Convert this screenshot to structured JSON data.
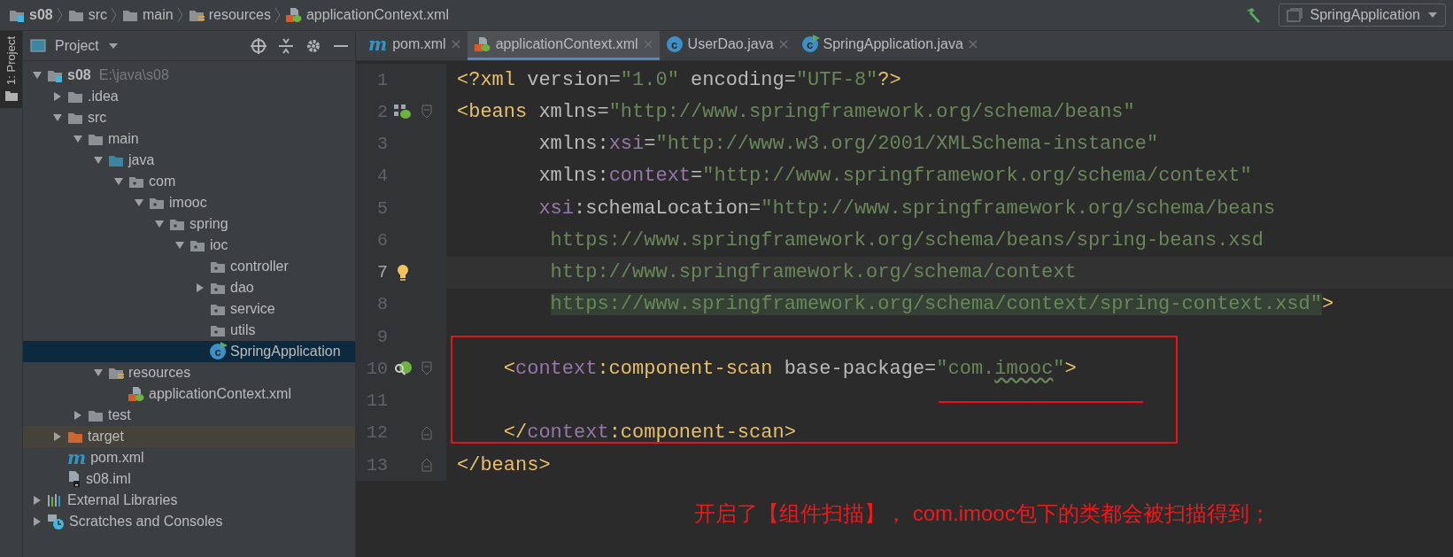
{
  "breadcrumb": [
    {
      "label": "s08",
      "kind": "module"
    },
    {
      "label": "src",
      "kind": "folder"
    },
    {
      "label": "main",
      "kind": "folder"
    },
    {
      "label": "resources",
      "kind": "resources"
    },
    {
      "label": "applicationContext.xml",
      "kind": "spring-xml"
    }
  ],
  "run_config": {
    "label": "SpringApplication"
  },
  "tool_strip": {
    "label": "1: Project"
  },
  "project_panel": {
    "title": "Project"
  },
  "tree": [
    {
      "label": "s08",
      "hint": "E:\\java\\s08",
      "kind": "module",
      "expanded": true,
      "selected": false,
      "children": [
        {
          "label": ".idea",
          "kind": "folder",
          "expanded": false,
          "selected": false
        },
        {
          "label": "src",
          "kind": "folder",
          "expanded": true,
          "selected": false,
          "children": [
            {
              "label": "main",
              "kind": "folder",
              "expanded": true,
              "selected": false,
              "children": [
                {
                  "label": "java",
                  "kind": "source",
                  "expanded": true,
                  "selected": false,
                  "children": [
                    {
                      "label": "com",
                      "kind": "package",
                      "expanded": true,
                      "selected": false,
                      "children": [
                        {
                          "label": "imooc",
                          "kind": "package",
                          "expanded": true,
                          "selected": false,
                          "children": [
                            {
                              "label": "spring",
                              "kind": "package",
                              "expanded": true,
                              "selected": false,
                              "children": [
                                {
                                  "label": "ioc",
                                  "kind": "package",
                                  "expanded": true,
                                  "selected": false,
                                  "children": [
                                    {
                                      "label": "controller",
                                      "kind": "package",
                                      "selected": false
                                    },
                                    {
                                      "label": "dao",
                                      "kind": "package",
                                      "expanded": false,
                                      "selected": false
                                    },
                                    {
                                      "label": "service",
                                      "kind": "package",
                                      "selected": false
                                    },
                                    {
                                      "label": "utils",
                                      "kind": "package",
                                      "selected": false
                                    },
                                    {
                                      "label": "SpringApplication",
                                      "kind": "spring-class",
                                      "icon_text": "c",
                                      "selected": true
                                    }
                                  ]
                                }
                              ]
                            }
                          ]
                        }
                      ]
                    }
                  ]
                },
                {
                  "label": "resources",
                  "kind": "resources",
                  "expanded": true,
                  "selected": false,
                  "children": [
                    {
                      "label": "applicationContext.xml",
                      "kind": "spring-xml",
                      "selected": false
                    }
                  ]
                }
              ]
            },
            {
              "label": "test",
              "kind": "folder",
              "expanded": false,
              "selected": false
            }
          ]
        },
        {
          "label": "target",
          "kind": "excluded",
          "expanded": false,
          "selected": false
        },
        {
          "label": "pom.xml",
          "kind": "maven",
          "icon_text": "m",
          "selected": false
        },
        {
          "label": "s08.iml",
          "kind": "iml",
          "selected": false
        }
      ]
    },
    {
      "label": "External Libraries",
      "kind": "libraries",
      "expanded": false,
      "selected": false
    },
    {
      "label": "Scratches and Consoles",
      "kind": "scratches",
      "expanded": false,
      "selected": false
    }
  ],
  "tabs": [
    {
      "label": "pom.xml",
      "kind": "maven",
      "icon_text": "m",
      "selected": false
    },
    {
      "label": "applicationContext.xml",
      "kind": "spring-xml",
      "selected": true
    },
    {
      "label": "UserDao.java",
      "kind": "class",
      "icon_text": "c",
      "selected": false
    },
    {
      "label": "SpringApplication.java",
      "kind": "spring-class",
      "icon_text": "c",
      "selected": false
    }
  ],
  "code_lines": [
    {
      "number": "1",
      "kind": "top",
      "current": false,
      "tokens": [
        {
          "text": "<?xml",
          "kind": "tag"
        },
        {
          "text": " version",
          "kind": "attr"
        },
        {
          "text": "=",
          "kind": "eq"
        },
        {
          "text": "\"1.0\"",
          "kind": "value"
        },
        {
          "text": " encoding",
          "kind": "attr"
        },
        {
          "text": "=",
          "kind": "eq"
        },
        {
          "text": "\"UTF-8\"",
          "kind": "value"
        },
        {
          "text": "?>",
          "kind": "tag"
        }
      ]
    },
    {
      "number": "2",
      "kind": "top",
      "gutter_icon": {
        "kind": "beans"
      },
      "fold": {
        "kind": "start"
      },
      "current": false,
      "tokens": [
        {
          "text": "<beans",
          "kind": "tag"
        },
        {
          "text": " xmlns",
          "kind": "attr"
        },
        {
          "text": "=",
          "kind": "eq"
        },
        {
          "text": "\"http://www.springframework.org/schema/beans\"",
          "kind": "value"
        }
      ]
    },
    {
      "number": "3",
      "kind": "attr",
      "current": false,
      "tokens": [
        {
          "text": "xmlns:",
          "kind": "attr"
        },
        {
          "text": "xsi",
          "kind": "ns"
        },
        {
          "text": "=",
          "kind": "eq"
        },
        {
          "text": "\"http://www.w3.org/2001/XMLSchema-instance\"",
          "kind": "value"
        }
      ]
    },
    {
      "number": "4",
      "kind": "attr",
      "current": false,
      "tokens": [
        {
          "text": "xmlns:",
          "kind": "attr"
        },
        {
          "text": "context",
          "kind": "ns"
        },
        {
          "text": "=",
          "kind": "eq"
        },
        {
          "text": "\"http://www.springframework.org/schema/context\"",
          "kind": "value"
        }
      ]
    },
    {
      "number": "5",
      "kind": "attr",
      "current": false,
      "tokens": [
        {
          "text": "xsi",
          "kind": "ns"
        },
        {
          "text": ":schemaLocation",
          "kind": "attr"
        },
        {
          "text": "=",
          "kind": "eq"
        },
        {
          "text": "\"http://www.springframework.org/schema/beans",
          "kind": "value"
        }
      ]
    },
    {
      "number": "6",
      "kind": "url",
      "current": false,
      "tokens": [
        {
          "text": "https://www.springframework.org/schema/beans/spring-beans.xsd",
          "kind": "value"
        }
      ]
    },
    {
      "number": "7",
      "kind": "url",
      "gutter_icon": {
        "kind": "bulb"
      },
      "current": true,
      "tokens": [
        {
          "text": "http://www.springframework.org/schema/context",
          "kind": "value"
        }
      ]
    },
    {
      "number": "8",
      "kind": "url",
      "current": false,
      "tokens": [
        {
          "text": "https://www.springframework.org/schema/context/spring-context.xsd\"",
          "kind": "matched-value"
        },
        {
          "text": ">",
          "kind": "matched-tag"
        }
      ]
    },
    {
      "number": "9",
      "current": false
    },
    {
      "number": "10",
      "kind": "child",
      "gutter_icon": {
        "kind": "scan"
      },
      "fold": {
        "kind": "start"
      },
      "current": false,
      "tokens": [
        {
          "text": "<",
          "kind": "tag"
        },
        {
          "text": "context",
          "kind": "ns"
        },
        {
          "text": ":component-scan",
          "kind": "tag"
        },
        {
          "text": " base-package",
          "kind": "attr"
        },
        {
          "text": "=",
          "kind": "eq"
        },
        {
          "text": "\"com.",
          "kind": "value"
        },
        {
          "text": "imooc",
          "kind": "typo"
        },
        {
          "text": "\"",
          "kind": "value"
        },
        {
          "text": ">",
          "kind": "tag"
        }
      ]
    },
    {
      "number": "11",
      "current": false
    },
    {
      "number": "12",
      "kind": "child",
      "fold": {
        "kind": "end"
      },
      "current": false,
      "tokens": [
        {
          "text": "</",
          "kind": "tag"
        },
        {
          "text": "context",
          "kind": "ns"
        },
        {
          "text": ":component-scan>",
          "kind": "tag"
        }
      ]
    },
    {
      "number": "13",
      "kind": "top",
      "fold": {
        "kind": "end"
      },
      "current": false,
      "tokens": [
        {
          "text": "</beans>",
          "kind": "tag"
        }
      ]
    }
  ],
  "annotation": {
    "text": "开启了【组件扫描】， com.imooc包下的类都会被扫描得到；"
  }
}
